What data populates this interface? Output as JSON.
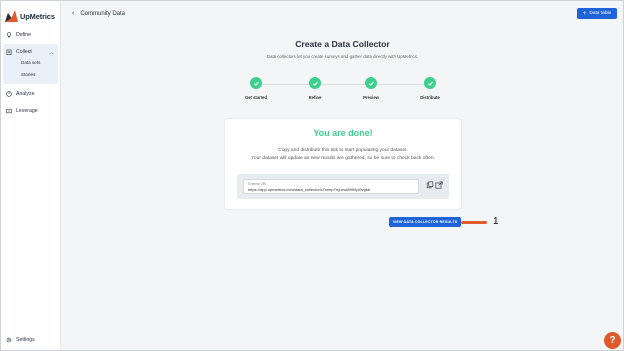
{
  "app": {
    "logo_text": "UpMetrics"
  },
  "sidebar": {
    "define": "Define",
    "collect": "Collect",
    "collect_subitems": [
      "Data sets",
      "Stories"
    ],
    "analyze": "Analyze",
    "leverage": "Leverage",
    "settings": "Settings"
  },
  "topbar": {
    "back_label": "Community Data",
    "data_table_button": "Data table"
  },
  "main": {
    "title": "Create a Data Collector",
    "subtitle": "Data collectors let you create surveys and gather data directly with UpMetrics.",
    "steps": [
      "Get started",
      "Refine",
      "Preview",
      "Distribute"
    ],
    "done_heading": "You are done!",
    "done_message_1": "Copy and distribute this link to start populating your dataset.",
    "done_message_2": "Your dataset will update as new results are gathered, so be sure to check back often.",
    "url_label": "External URL",
    "url_value": "https://app.upmetrics.com/data_collector/rZmmp7rrjuxwl8990pl9vgtdr",
    "view_results_button": "VIEW DATA COLLECTOR RESULTS",
    "callout_number": "1"
  },
  "help": {
    "label": "?"
  },
  "colors": {
    "accent": "#1e64d8",
    "success": "#3ecf8e",
    "annotation": "#e05a2b"
  }
}
